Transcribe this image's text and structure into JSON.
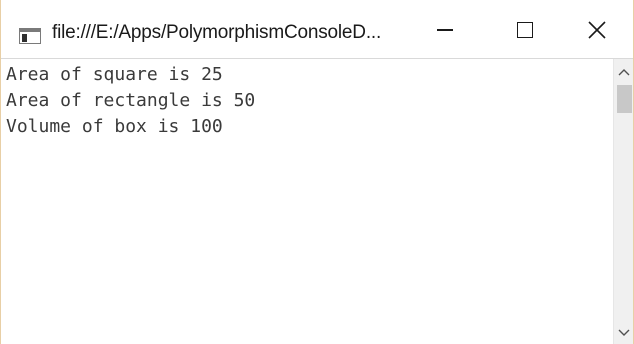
{
  "window": {
    "title": "file:///E:/Apps/PolymorphismConsoleD...",
    "icon": "console-app-icon"
  },
  "caption_buttons": {
    "minimize_icon": "minimize-icon",
    "maximize_icon": "maximize-icon",
    "close_icon": "close-icon"
  },
  "console": {
    "lines": [
      "Area of square is 25",
      "Area of rectangle is 50",
      "Volume of box is 100"
    ]
  },
  "scrollbar": {
    "up_icon": "chevron-up-icon",
    "down_icon": "chevron-down-icon"
  },
  "colors": {
    "text": "#3a3a3a",
    "frame_border": "#e8cfa6",
    "scrollbar_track": "#f0f0f0",
    "scrollbar_thumb": "#c8c8c8"
  }
}
